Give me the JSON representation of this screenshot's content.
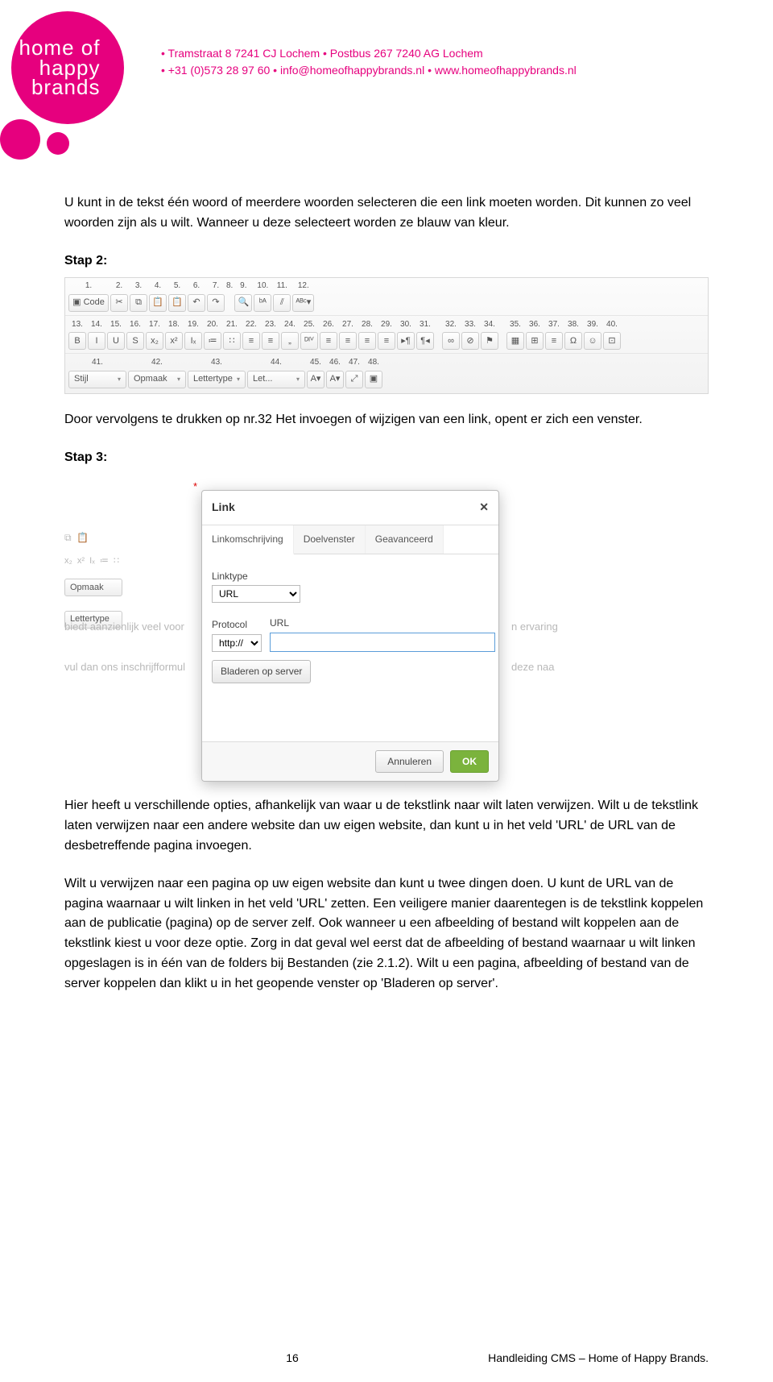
{
  "header": {
    "logo_line1": "home of",
    "logo_line2": "happy",
    "logo_line3": "brands",
    "contact_line1": "• Tramstraat 8  7241 CJ  Lochem • Postbus 267  7240 AG  Lochem",
    "contact_line2": "• +31 (0)573 28 97 60 • info@homeofhappybrands.nl • www.homeofhappybrands.nl"
  },
  "body": {
    "p1": "U kunt in de tekst één woord of meerdere woorden selecteren die een link moeten worden. Dit kunnen zo veel woorden zijn als u wilt. Wanneer u deze selecteert worden ze blauw van kleur.",
    "step2_label": "Stap 2:",
    "toolbar": {
      "row1_nums": [
        "1.",
        "2.",
        "3.",
        "4.",
        "5.",
        "6.",
        "7.",
        "8.",
        "9.",
        "10.",
        "11.",
        "12."
      ],
      "row1_btns": [
        "Code",
        "✂",
        "⧉",
        "📋",
        "📋",
        "↶",
        "↷",
        "",
        "🔍",
        "ᵇᴬ",
        "⫽",
        "ᴬᴮᶜ▾"
      ],
      "row2_nums": [
        "13.",
        "14.",
        "15.",
        "16.",
        "17.",
        "18.",
        "19.",
        "20.",
        "21.",
        "22.",
        "23.",
        "24.",
        "25.",
        "26.",
        "27.",
        "28.",
        "29.",
        "30.",
        "31.",
        "",
        "32.",
        "33.",
        "34.",
        "",
        "35.",
        "36.",
        "37.",
        "38.",
        "39.",
        "40."
      ],
      "row2_btns": [
        "B",
        "I",
        "U",
        "S",
        "x₂",
        "x²",
        "Iₓ",
        "≔",
        "∷",
        "≡",
        "≡",
        "„",
        "ᴰᴵⱽ",
        "≡",
        "≡",
        "≡",
        "≡",
        "▸¶",
        "¶◂",
        "",
        "∞",
        "⊘",
        "⚑",
        "",
        "▦",
        "⊞",
        "≡",
        "Ω",
        "☺",
        "⊡"
      ],
      "row3_nums": [
        "",
        "41.",
        "",
        "42.",
        "",
        "43.",
        "",
        "44.",
        "45.",
        "46.",
        "47.",
        "48."
      ],
      "row3_selects": [
        "Stijl",
        "Opmaak",
        "Lettertype",
        "Let..."
      ],
      "row3_btns_after": [
        "A▾",
        "A▾",
        "⤢",
        "▣"
      ]
    },
    "p2": "Door vervolgens te drukken op nr.32 Het invoegen of wijzigen van een link, opent er zich een venster.",
    "step3_label": "Stap 3:",
    "dialog": {
      "title": "Link",
      "tabs": [
        "Linkomschrijving",
        "Doelvenster",
        "Geavanceerd"
      ],
      "linktype_label": "Linktype",
      "linktype_value": "URL",
      "protocol_label": "Protocol",
      "protocol_value": "http://",
      "url_label": "URL",
      "url_value": "",
      "browse_btn": "Bladeren op server",
      "cancel": "Annuleren",
      "ok": "OK"
    },
    "bg_texts": {
      "a": "biedt aanzienlijk veel voor",
      "b": "n ervaring",
      "c": "vul dan ons inschrijfformul",
      "d": "deze naa",
      "star": "*",
      "sel_opmaak": "Opmaak",
      "sel_letter": "Lettertype"
    },
    "p3": "Hier heeft u verschillende opties, afhankelijk van waar u de tekstlink naar wilt laten verwijzen. Wilt u de tekstlink laten verwijzen naar een andere website dan uw eigen website, dan kunt u in het veld 'URL' de URL van de desbetreffende pagina invoegen.",
    "p4": "Wilt u verwijzen naar een pagina op uw eigen website dan kunt u twee dingen doen. U kunt de URL van de pagina waarnaar u wilt linken in het veld 'URL' zetten. Een veiligere manier daarentegen is de tekstlink koppelen aan de publicatie (pagina) op de server zelf. Ook wanneer u een afbeelding of bestand wilt koppelen aan de tekstlink kiest u voor deze optie. Zorg in dat geval wel eerst dat de afbeelding of bestand waarnaar u wilt linken opgeslagen is in één van de folders bij Bestanden (zie 2.1.2). Wilt u een pagina, afbeelding of bestand van de server koppelen dan klikt u in het geopende venster op 'Bladeren op server'."
  },
  "footer": {
    "page": "16",
    "doc": "Handleiding CMS – Home of Happy Brands."
  }
}
